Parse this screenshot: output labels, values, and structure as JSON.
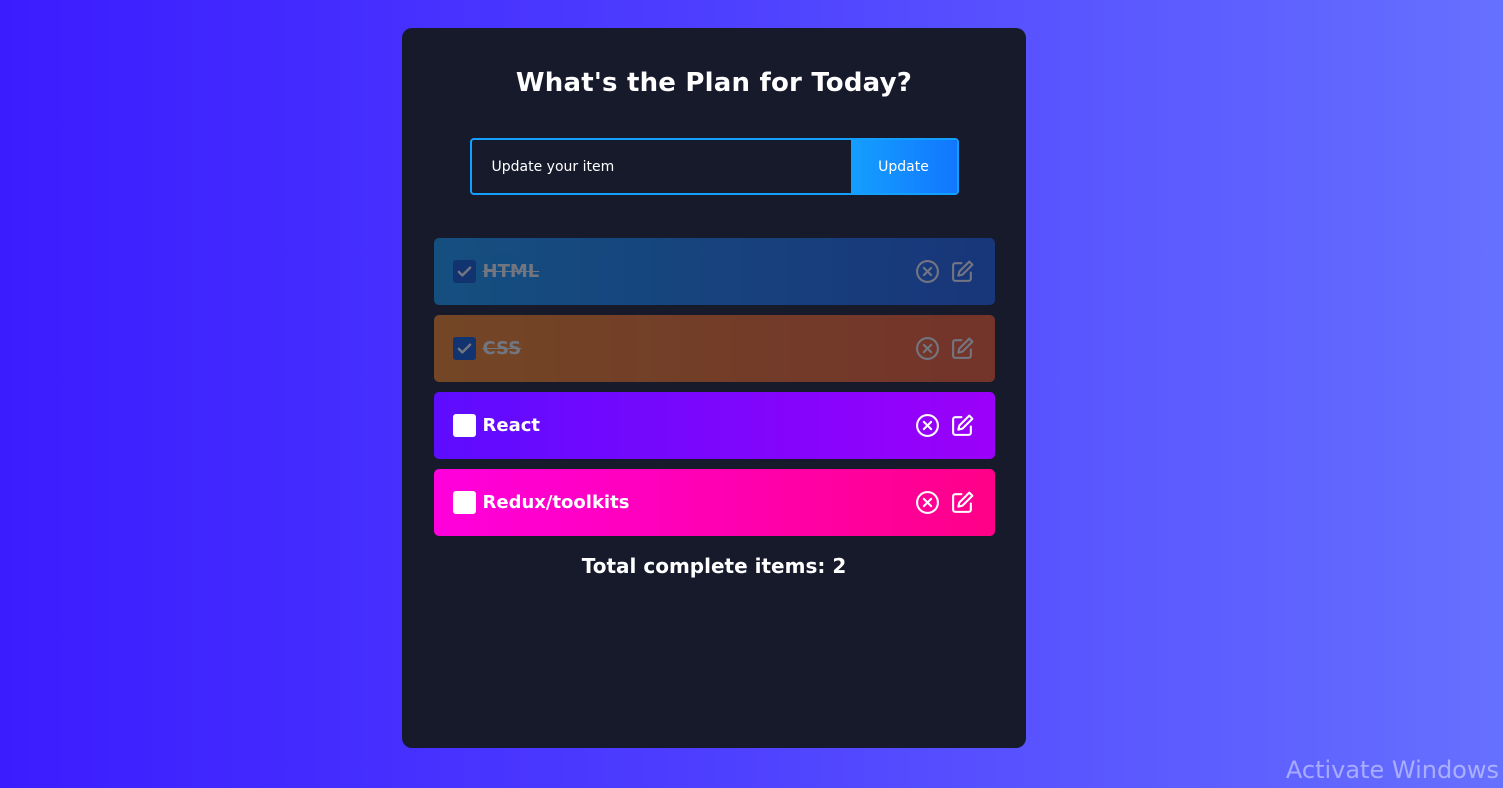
{
  "app": {
    "title": "What's the Plan for Today?"
  },
  "form": {
    "input_value": "Update your item",
    "button_label": "Update"
  },
  "items": [
    {
      "label": "HTML",
      "completed": true,
      "color_start": "#149fff",
      "color_end": "#1c60f0"
    },
    {
      "label": "CSS",
      "completed": true,
      "color_start": "#ff8a1e",
      "color_end": "#ff5a2a"
    },
    {
      "label": "React",
      "completed": false,
      "color_start": "#5d0cff",
      "color_end": "#9b00fa"
    },
    {
      "label": "Redux/toolkits",
      "completed": false,
      "color_start": "#ff00dd",
      "color_end": "#ff0088"
    }
  ],
  "item_icons": {
    "remove": "close-circle-icon",
    "edit": "edit-icon",
    "check": "checkmark-icon"
  },
  "footer": {
    "total_text": "Total complete items: 2"
  },
  "watermark": {
    "text": "Activate Windows"
  },
  "colors": {
    "panel": "#161a2b",
    "accent": "#149fff",
    "background_start": "#3b1cff",
    "background_end": "#6670ff"
  }
}
